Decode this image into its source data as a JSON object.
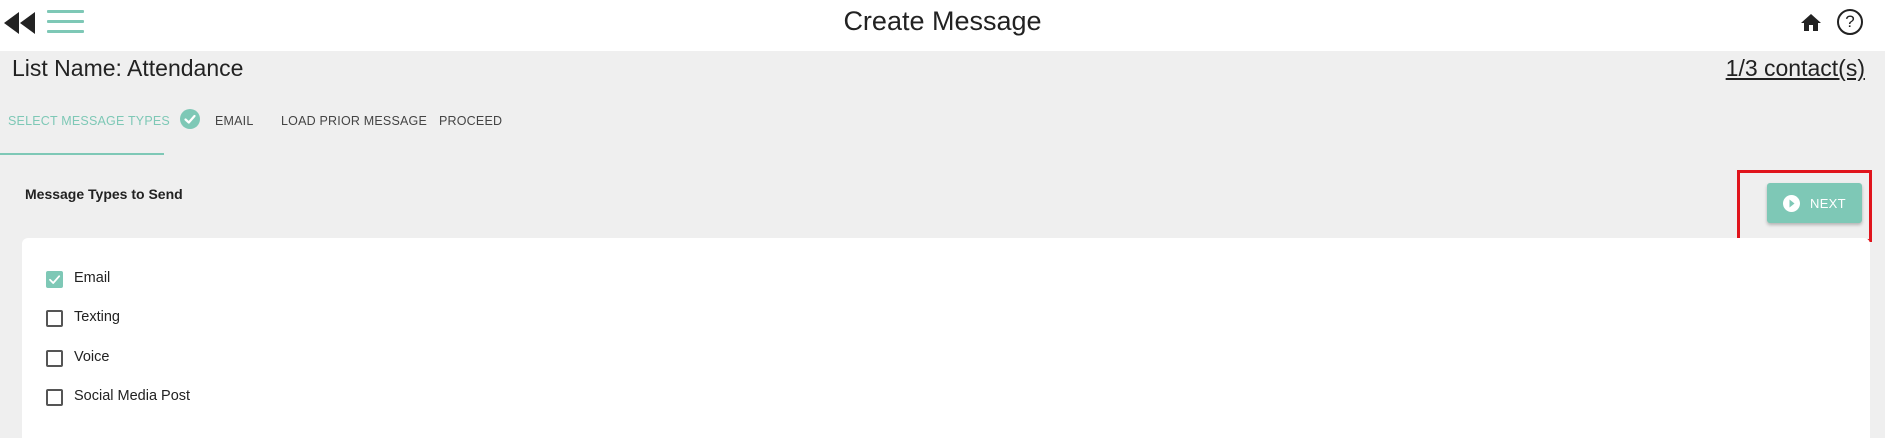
{
  "header": {
    "title": "Create Message",
    "back_icon": "double-chevron-left-icon",
    "menu_icon": "hamburger-menu-icon",
    "home_icon": "home-icon",
    "help_icon": "help-circle-icon",
    "help_glyph": "?"
  },
  "list": {
    "name": "List Name: Attendance",
    "contacts": "1/3 contact(s)"
  },
  "tabs": [
    {
      "label": "SELECT MESSAGE TYPES",
      "state": "active"
    },
    {
      "label": "EMAIL",
      "state": "completed"
    },
    {
      "label": "LOAD PRIOR MESSAGE",
      "state": "pending"
    },
    {
      "label": "PROCEED",
      "state": "pending"
    }
  ],
  "section": {
    "title": "Message Types to Send"
  },
  "next_button": {
    "label": "NEXT",
    "icon": "arrow-right-circle-icon",
    "highlighted": true
  },
  "message_types": [
    {
      "label": "Email",
      "checked": true
    },
    {
      "label": "Texting",
      "checked": false
    },
    {
      "label": "Voice",
      "checked": false
    },
    {
      "label": "Social Media Post",
      "checked": false
    }
  ],
  "colors": {
    "accent": "#7ec8b6",
    "highlight": "#e0141c",
    "background": "#efefef"
  }
}
